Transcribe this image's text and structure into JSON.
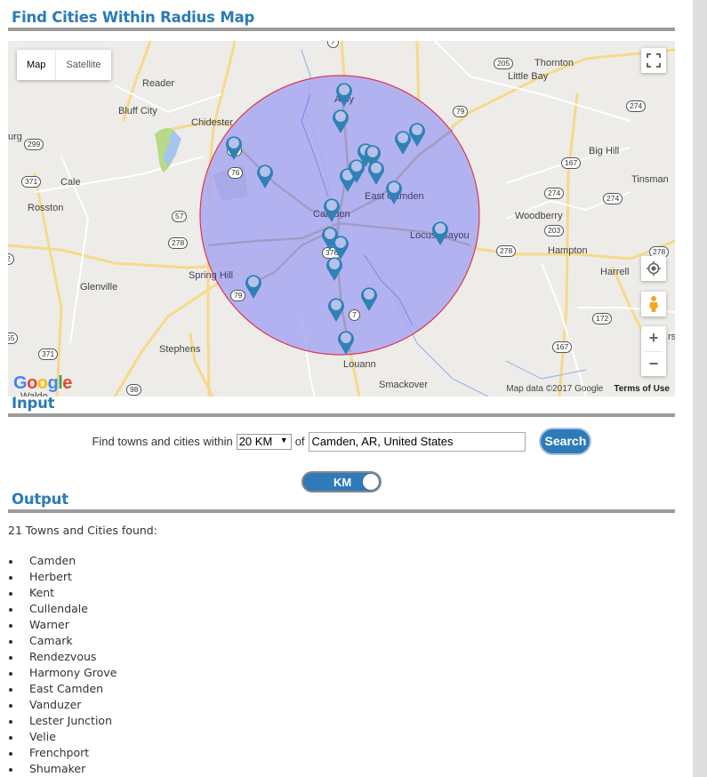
{
  "page": {
    "map_section_title": "Find Cities Within Radius Map",
    "input_section_title": "Input",
    "output_section_title": "Output"
  },
  "map": {
    "type_buttons": [
      {
        "label": "Map",
        "active": true
      },
      {
        "label": "Satellite",
        "active": false
      }
    ],
    "logo": [
      "G",
      "o",
      "o",
      "g",
      "l",
      "e"
    ],
    "logo_colors": [
      "#4285f4",
      "#ea4335",
      "#fbbc05",
      "#4285f4",
      "#34a853",
      "#ea4335"
    ],
    "attribution": "Map data ©2017 Google",
    "terms": "Terms of Use",
    "circle_fill": "#a8a8f2",
    "circle_stroke": "#e2344d",
    "marker_color": "#2e82b6",
    "place_labels": [
      {
        "text": "Reader"
      },
      {
        "text": "Bluff City"
      },
      {
        "text": "Chidester"
      },
      {
        "text": "urg"
      },
      {
        "text": "Cale"
      },
      {
        "text": "Rosston"
      },
      {
        "text": "Glenville"
      },
      {
        "text": "Spring Hill"
      },
      {
        "text": "Stephens"
      },
      {
        "text": "Louann"
      },
      {
        "text": "Smackover"
      },
      {
        "text": "Amy"
      },
      {
        "text": "Camden"
      },
      {
        "text": "East Camden"
      },
      {
        "text": "Locust Bayou"
      },
      {
        "text": "Thornton"
      },
      {
        "text": "Little Bay"
      },
      {
        "text": "Big Hill"
      },
      {
        "text": "Tinsman"
      },
      {
        "text": "Woodberry"
      },
      {
        "text": "Hampton"
      },
      {
        "text": "Harrell"
      },
      {
        "text": "rsc"
      },
      {
        "text": "Waldo"
      }
    ],
    "route_shields": [
      "299",
      "371",
      "57",
      "278",
      "24",
      "76",
      "79",
      "205",
      "274",
      "167",
      "274",
      "274",
      "203",
      "278",
      "278",
      "172",
      "167",
      "376",
      "7",
      "79",
      "371",
      "98",
      "55",
      "2",
      "7"
    ],
    "controls": {
      "fullscreen": "fullscreen-icon",
      "locate": "my-location-icon",
      "pegman": "street-view-pegman-icon",
      "zoom_in": "+",
      "zoom_out": "−"
    }
  },
  "input": {
    "prefix_label": "Find towns and cities within",
    "radius_value": "20 KM",
    "radius_caret": "▼",
    "of_label": "of",
    "location_value": "Camden, AR, United States",
    "search_label": "Search",
    "unit_toggle_label": "KM",
    "unit_toggle_on": true
  },
  "output": {
    "count_text": "21 Towns and Cities found:",
    "cities": [
      "Camden",
      "Herbert",
      "Kent",
      "Cullendale",
      "Warner",
      "Camark",
      "Rendezvous",
      "Harmony Grove",
      "East Camden",
      "Vanduzer",
      "Lester Junction",
      "Velie",
      "Frenchport",
      "Shumaker"
    ]
  }
}
